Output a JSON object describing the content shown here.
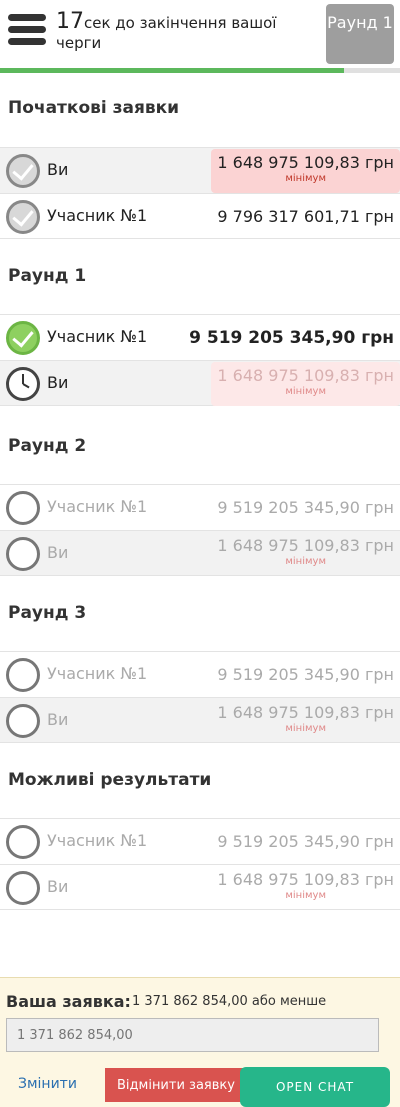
{
  "header": {
    "countdown_number": "17",
    "countdown_text": "сек до закінчення вашої черги",
    "round_badge": "Раунд 1",
    "progress": 0.86
  },
  "sections": {
    "initial": {
      "title": "Початкові заявки",
      "rows": [
        {
          "name": "Ви",
          "amount": "1 648 975 109,83 грн",
          "note": "мінімум"
        },
        {
          "name": "Учасник №1",
          "amount": "9 796 317 601,71 грн"
        }
      ]
    },
    "round1": {
      "title": "Раунд 1",
      "rows": [
        {
          "name": "Учасник №1",
          "amount": "9 519 205 345,90 грн"
        },
        {
          "name": "Ви",
          "amount": "1 648 975 109,83 грн",
          "note": "мінімум"
        }
      ]
    },
    "round2": {
      "title": "Раунд 2",
      "rows": [
        {
          "name": "Учасник №1",
          "amount": "9 519 205 345,90 грн"
        },
        {
          "name": "Ви",
          "amount": "1 648 975 109,83 грн",
          "note": "мінімум"
        }
      ]
    },
    "round3": {
      "title": "Раунд 3",
      "rows": [
        {
          "name": "Учасник №1",
          "amount": "9 519 205 345,90 грн"
        },
        {
          "name": "Ви",
          "amount": "1 648 975 109,83 грн",
          "note": "мінімум"
        }
      ]
    },
    "results": {
      "title": "Можливі результати",
      "rows": [
        {
          "name": "Учасник №1",
          "amount": "9 519 205 345,90 грн"
        },
        {
          "name": "Ви",
          "amount": "1 648 975 109,83 грн",
          "note": "мінімум"
        }
      ]
    }
  },
  "bid_panel": {
    "label": "Ваша заявка:",
    "value_text": "1 371 862 854,00 або менше",
    "input_placeholder": "1 371 862 854,00",
    "edit_label": "Змінити",
    "cancel_label": "Відмінити заявку",
    "chat_label": "OPEN CHAT"
  },
  "colors": {
    "progress": "#5cb85c",
    "minimum_bg": "#fbd3d3",
    "cancel": "#d9534f",
    "chat": "#26b68a"
  }
}
